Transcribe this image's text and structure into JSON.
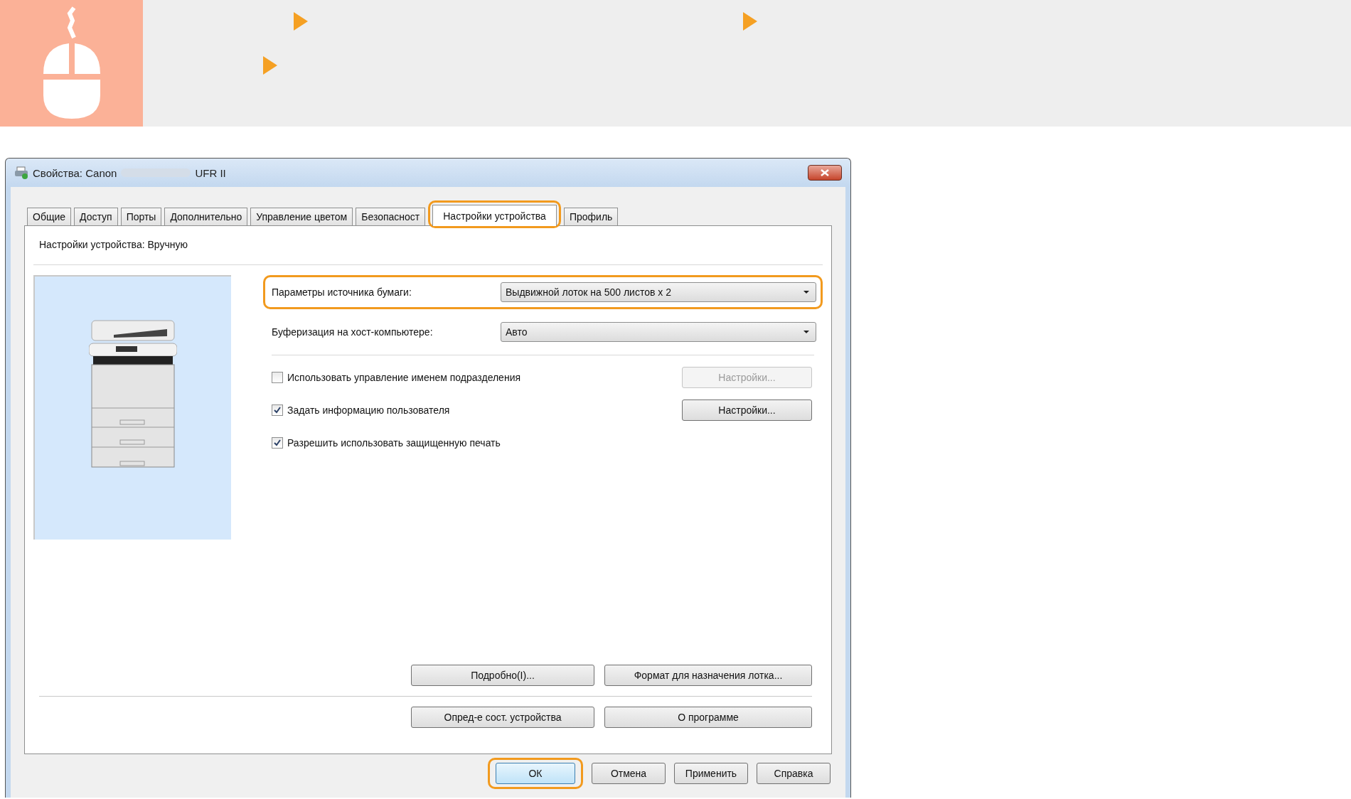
{
  "window": {
    "title": "Свойства: Canon",
    "title_suffix": "UFR II"
  },
  "tabs": [
    {
      "label": "Общие",
      "selected": false,
      "highlighted": false
    },
    {
      "label": "Доступ",
      "selected": false,
      "highlighted": false
    },
    {
      "label": "Порты",
      "selected": false,
      "highlighted": false
    },
    {
      "label": "Дополнительно",
      "selected": false,
      "highlighted": false
    },
    {
      "label": "Управление цветом",
      "selected": false,
      "highlighted": false
    },
    {
      "label": "Безопасност",
      "selected": false,
      "highlighted": false
    },
    {
      "label": "Настройки устройства",
      "selected": true,
      "highlighted": true
    },
    {
      "label": "Профиль",
      "selected": false,
      "highlighted": false
    }
  ],
  "panel": {
    "mode_label": "Настройки устройства: Вручную",
    "settings": [
      {
        "label": "Параметры источника бумаги:",
        "value": "Выдвижной лоток на 500 листов x 2",
        "highlighted": true
      },
      {
        "label": "Буферизация на хост-компьютере:",
        "value": "Авто",
        "highlighted": false
      }
    ],
    "options": [
      {
        "label": "Использовать управление именем подразделения",
        "checked": false,
        "button": {
          "label": "Настройки...",
          "disabled": true
        }
      },
      {
        "label": "Задать информацию пользователя",
        "checked": true,
        "button": {
          "label": "Настройки...",
          "disabled": false
        }
      },
      {
        "label": "Разрешить использовать защищенную печать",
        "checked": true
      }
    ],
    "detail_buttons": [
      "Подробно(I)...",
      "Формат для назначения лотка..."
    ],
    "info_buttons": [
      "Опред-е сост. устройства",
      "О программе"
    ]
  },
  "buttons": [
    {
      "label": "ОК",
      "default": true,
      "highlighted": true
    },
    {
      "label": "Отмена",
      "default": false,
      "highlighted": false
    },
    {
      "label": "Применить",
      "default": false,
      "highlighted": false
    },
    {
      "label": "Справка",
      "default": false,
      "highlighted": false
    }
  ]
}
